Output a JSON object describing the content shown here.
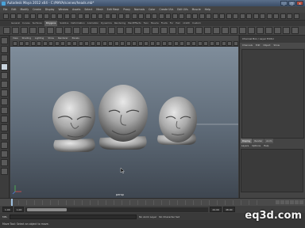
{
  "app": {
    "title": "Autodesk Maya 2012 x64 - C:/MAYA/scenes/heads.mb*",
    "window_buttons": [
      "_",
      "□",
      "x"
    ]
  },
  "menubar": {
    "items": [
      "File",
      "Edit",
      "Modify",
      "Create",
      "Display",
      "Window",
      "Assets",
      "Select",
      "Mesh",
      "Edit Mesh",
      "Proxy",
      "Normals",
      "Color",
      "Create UVs",
      "Edit UVs",
      "Muscle",
      "Help"
    ]
  },
  "shelf": {
    "tabs": [
      "General",
      "Curves",
      "Surfaces",
      "Polygons",
      "Subdivs",
      "Deformation",
      "Animation",
      "Dynamics",
      "Rendering",
      "PaintEffects",
      "Toon",
      "Muscle",
      "Fluids",
      "Fur",
      "Hair",
      "nCloth",
      "Custom"
    ],
    "selected_tab": "Polygons"
  },
  "viewport": {
    "menu": [
      "View",
      "Shading",
      "Lighting",
      "Show",
      "Renderer",
      "Panels"
    ],
    "camera_label": "persp",
    "models": [
      "head-model-left",
      "head-model-center",
      "head-model-right"
    ]
  },
  "channel_box": {
    "title": "Channel Box / Layer Editor",
    "tabs": [
      "Channels",
      "Edit",
      "Object",
      "Show"
    ]
  },
  "layer_editor": {
    "tabs": [
      "Display",
      "Render",
      "Anim"
    ],
    "selected_tab": "Display",
    "menu": [
      "Layers",
      "Options",
      "Help"
    ]
  },
  "time_slider": {
    "current_frame": "1"
  },
  "range_slider": {
    "start": "1.00",
    "inner_start": "1.00",
    "inner_end": "24",
    "end": "24.00",
    "end2": "48.00",
    "anim_layer": "No Anim Layer",
    "char_set": "No Character Set"
  },
  "command_line": {
    "label": "MEL"
  },
  "help_line": {
    "text": "Move Tool: Select an object to move."
  },
  "watermark": {
    "text": "eq3d.com"
  },
  "colors": {
    "viewport_top": "#7f8d9b",
    "viewport_bottom": "#3e4650",
    "model_grey": "#b4b4b4"
  }
}
